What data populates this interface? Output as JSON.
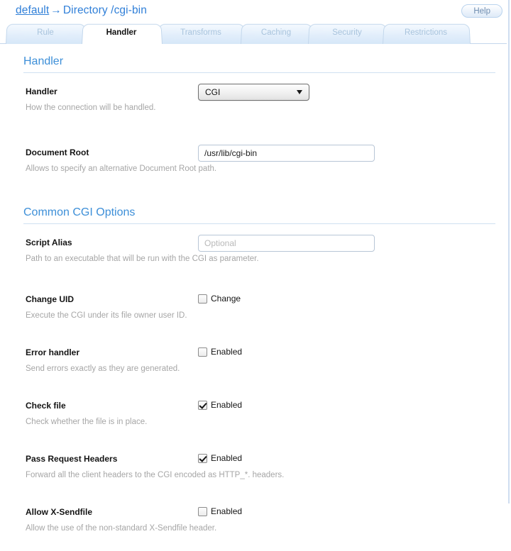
{
  "header": {
    "breadcrumb": {
      "link_text": "default",
      "separator": "→",
      "current": "Directory /cgi-bin"
    },
    "help_label": "Help"
  },
  "tabs": [
    {
      "label": "Rule",
      "active": false
    },
    {
      "label": "Handler",
      "active": true
    },
    {
      "label": "Transforms",
      "active": false
    },
    {
      "label": "Caching",
      "active": false
    },
    {
      "label": "Security",
      "active": false
    },
    {
      "label": "Restrictions",
      "active": false
    }
  ],
  "sections": [
    {
      "title": "Handler",
      "fields": [
        {
          "label": "Handler",
          "help": "How the connection will be handled.",
          "control": "select",
          "value": "CGI"
        },
        {
          "label": "Document Root",
          "help": "Allows to specify an alternative Document Root path.",
          "control": "text",
          "value": "/usr/lib/cgi-bin",
          "placeholder": ""
        }
      ]
    },
    {
      "title": "Common CGI Options",
      "fields": [
        {
          "label": "Script Alias",
          "help": "Path to an executable that will be run with the CGI as parameter.",
          "control": "text",
          "value": "",
          "placeholder": "Optional"
        },
        {
          "label": "Change UID",
          "help": "Execute the CGI under its file owner user ID.",
          "control": "checkbox",
          "checkbox_label": "Change",
          "checked": false
        },
        {
          "label": "Error handler",
          "help": "Send errors exactly as they are generated.",
          "control": "checkbox",
          "checkbox_label": "Enabled",
          "checked": false
        },
        {
          "label": "Check file",
          "help": "Check whether the file is in place.",
          "control": "checkbox",
          "checkbox_label": "Enabled",
          "checked": true
        },
        {
          "label": "Pass Request Headers",
          "help": "Forward all the client headers to the CGI encoded as HTTP_*. headers.",
          "control": "checkbox",
          "checkbox_label": "Enabled",
          "checked": true
        },
        {
          "label": "Allow X-Sendfile",
          "help": "Allow the use of the non-standard X-Sendfile header.",
          "control": "checkbox",
          "checkbox_label": "Enabled",
          "checked": false
        }
      ]
    }
  ],
  "colors": {
    "accent": "#3d8fd8",
    "link": "#2f7fd8",
    "tab_inactive_text": "#a9c4dd",
    "help_text": "#a6a6a6",
    "rule": "#cfe0f1"
  }
}
